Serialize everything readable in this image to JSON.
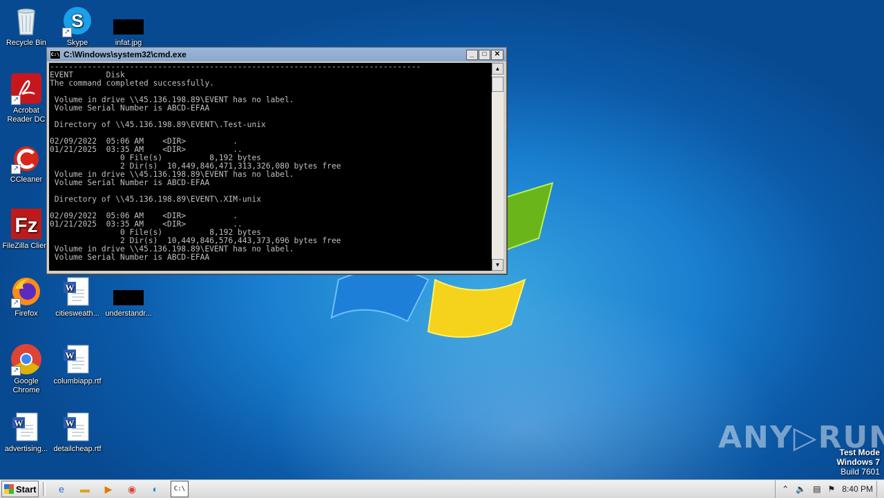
{
  "desktop": {
    "icons": [
      {
        "label": "Recycle Bin",
        "icon": "recycle-bin-icon"
      },
      {
        "label": "Skype",
        "icon": "skype-icon"
      },
      {
        "label": "infat.jpg",
        "icon": "image-file-icon"
      },
      {
        "label": "Acrobat Reader DC",
        "line1": "Acrobat",
        "line2": "Reader DC",
        "icon": "acrobat-icon"
      },
      {
        "label": "CCleaner",
        "icon": "ccleaner-icon"
      },
      {
        "label": "FileZilla Client",
        "icon": "filezilla-icon"
      },
      {
        "label": "Firefox",
        "icon": "firefox-icon"
      },
      {
        "label": "citiesweath...",
        "icon": "word-document-icon"
      },
      {
        "label": "understandr...",
        "icon": "image-file-icon"
      },
      {
        "label": "Google Chrome",
        "line1": "Google",
        "line2": "Chrome",
        "icon": "chrome-icon"
      },
      {
        "label": "columbiapp.rtf",
        "icon": "word-document-icon"
      },
      {
        "label": "advertising...",
        "icon": "word-document-icon"
      },
      {
        "label": "detailcheap.rtf",
        "icon": "word-document-icon"
      }
    ]
  },
  "cmd_window": {
    "title": "C:\\Windows\\system32\\cmd.exe",
    "lines": [
      "-------------------------------------------------------------------------------",
      "EVENT       Disk",
      "The command completed successfully.",
      "",
      " Volume in drive \\\\45.136.198.89\\EVENT has no label.",
      " Volume Serial Number is ABCD-EFAA",
      "",
      " Directory of \\\\45.136.198.89\\EVENT\\.Test-unix",
      "",
      "02/09/2022  05:06 AM    <DIR>          .",
      "01/21/2025  03:35 AM    <DIR>          ..",
      "               0 File(s)          8,192 bytes",
      "               2 Dir(s)  10,449,846,471,313,326,080 bytes free",
      " Volume in drive \\\\45.136.198.89\\EVENT has no label.",
      " Volume Serial Number is ABCD-EFAA",
      "",
      " Directory of \\\\45.136.198.89\\EVENT\\.XIM-unix",
      "",
      "02/09/2022  05:06 AM    <DIR>          .",
      "01/21/2025  03:35 AM    <DIR>          ..",
      "               0 File(s)          8,192 bytes",
      "               2 Dir(s)  10,449,846,576,443,373,696 bytes free",
      " Volume in drive \\\\45.136.198.89\\EVENT has no label.",
      " Volume Serial Number is ABCD-EFAA"
    ],
    "buttons": {
      "minimize": "_",
      "maximize": "□",
      "close": "✕"
    }
  },
  "taskbar": {
    "start_label": "Start",
    "clock": "8:40 PM"
  },
  "watermark": {
    "brand": "ANY▷RUN",
    "test_mode_line1": "Test Mode",
    "test_mode_line2": "Windows 7",
    "test_mode_line3": "Build 7601"
  }
}
